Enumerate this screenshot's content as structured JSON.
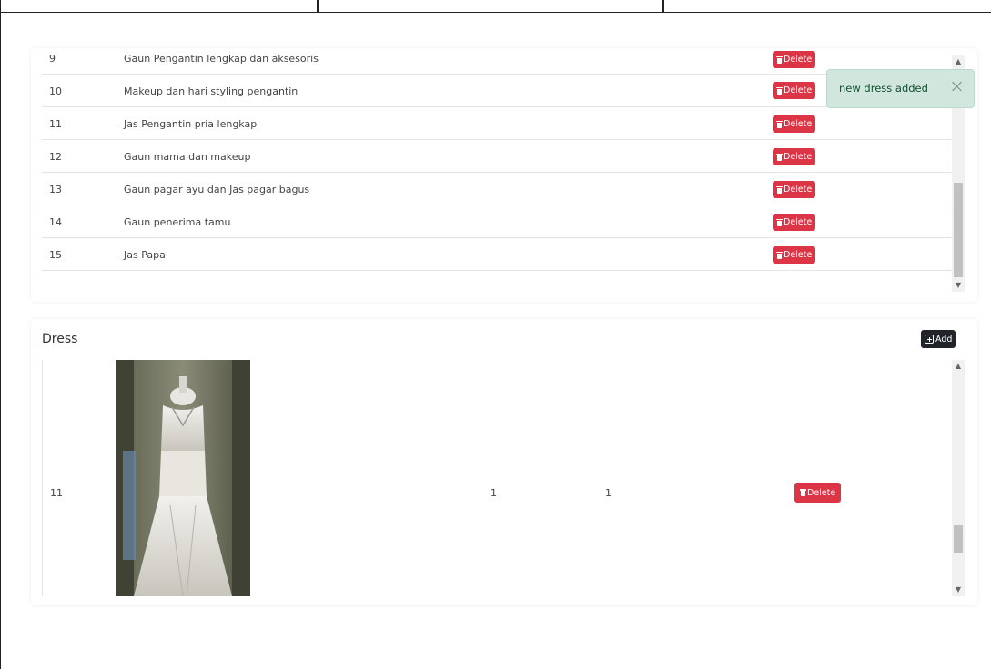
{
  "services_table": {
    "rows": [
      {
        "num": "9",
        "name": "Gaun Pengantin lengkap dan aksesoris",
        "delete_label": "Delete"
      },
      {
        "num": "10",
        "name": "Makeup dan hari styling pengantin",
        "delete_label": "Delete"
      },
      {
        "num": "11",
        "name": "Jas Pengantin pria lengkap",
        "delete_label": "Delete"
      },
      {
        "num": "12",
        "name": "Gaun mama dan makeup",
        "delete_label": "Delete"
      },
      {
        "num": "13",
        "name": "Gaun pagar ayu dan Jas pagar bagus",
        "delete_label": "Delete"
      },
      {
        "num": "14",
        "name": "Gaun penerima tamu",
        "delete_label": "Delete"
      },
      {
        "num": "15",
        "name": "Jas Papa",
        "delete_label": "Delete"
      }
    ]
  },
  "dress_section": {
    "title": "Dress",
    "add_label": "Add",
    "rows": [
      {
        "num": "11",
        "col3": "1",
        "col4": "1",
        "delete_label": "Delete"
      }
    ]
  },
  "toast": {
    "message": "new dress added"
  },
  "colors": {
    "danger": "#dc3545",
    "dark": "#212529",
    "toast_bg": "#d1e7dd",
    "toast_text": "#0f5132"
  },
  "icons": [
    "trash-icon",
    "plus-square-icon",
    "close-icon",
    "chevron-up-icon",
    "chevron-down-icon"
  ]
}
